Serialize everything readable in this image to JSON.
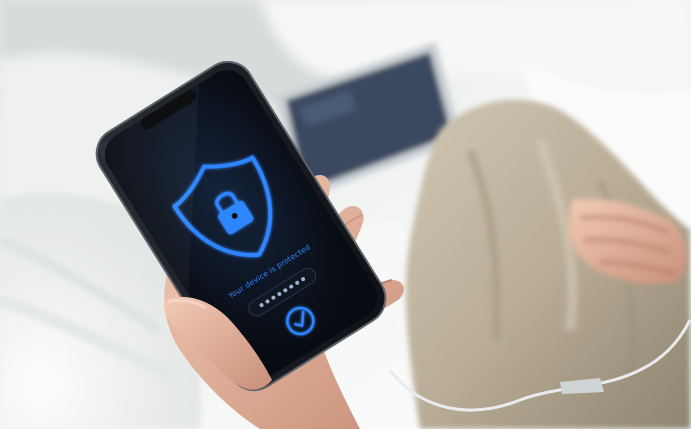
{
  "phone": {
    "status_text": "Your device is protected",
    "accent_color": "#2f86ff",
    "screen_color": "#0b0f16",
    "icons": [
      "shield-icon",
      "lock-icon",
      "checkmark-circle-icon"
    ],
    "passcode_dots_count": 8
  },
  "scene_colors": {
    "bedding": "#f3f5f4",
    "pants": "#c2b7a3",
    "tablet_screen": "#3b4a61",
    "skin": "#e7b9a2"
  }
}
